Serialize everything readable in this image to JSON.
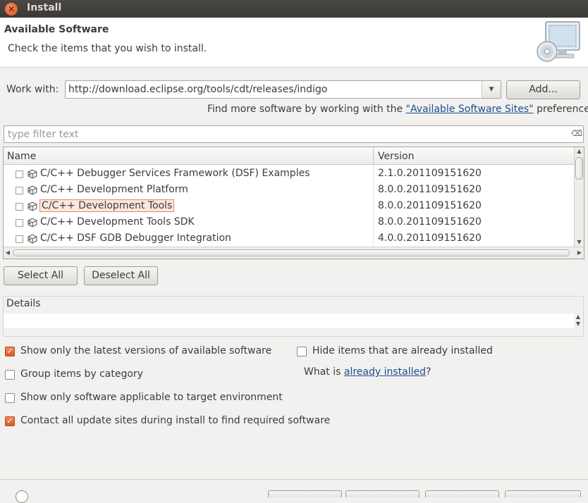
{
  "window": {
    "title": "Install",
    "close_glyph": "✕"
  },
  "header": {
    "title": "Available Software",
    "subtitle": "Check the items that you wish to install.",
    "icon": "monitor-cd-icon"
  },
  "work_with": {
    "label": "Work with:",
    "value": "http://download.eclipse.org/tools/cdt/releases/indigo",
    "add_button": "Add..."
  },
  "find_more": {
    "prefix": "Find more software by working with the ",
    "link": "\"Available Software Sites\"",
    "suffix": " preferences."
  },
  "filter": {
    "placeholder": "type filter text",
    "clear_icon": "clear-filter-icon"
  },
  "table": {
    "columns": [
      "Name",
      "Version"
    ],
    "rows": [
      {
        "name": "C/C++ Debugger Services Framework (DSF) Examples",
        "version": "2.1.0.201109151620",
        "checked": false,
        "selected": false
      },
      {
        "name": "C/C++ Development Platform",
        "version": "8.0.0.201109151620",
        "checked": false,
        "selected": false
      },
      {
        "name": "C/C++ Development Tools",
        "version": "8.0.0.201109151620",
        "checked": false,
        "selected": true
      },
      {
        "name": "C/C++ Development Tools SDK",
        "version": "8.0.0.201109151620",
        "checked": false,
        "selected": false
      },
      {
        "name": "C/C++ DSF GDB Debugger Integration",
        "version": "4.0.0.201109151620",
        "checked": false,
        "selected": false
      }
    ]
  },
  "buttons": {
    "select_all": "Select All",
    "deselect_all": "Deselect All"
  },
  "details": {
    "label": "Details",
    "text": ""
  },
  "options": {
    "latest_versions": {
      "label": "Show only the latest versions of available software",
      "checked": true
    },
    "group_by_category": {
      "label": "Group items by category",
      "checked": false
    },
    "target_env": {
      "label": "Show only software applicable to target environment",
      "checked": false
    },
    "contact_sites": {
      "label": "Contact all update sites during install to find required software",
      "checked": true
    },
    "hide_installed": {
      "label": "Hide items that are already installed",
      "checked": false
    }
  },
  "what_is": {
    "prefix": "What is ",
    "link": "already installed",
    "suffix": "?"
  },
  "colors": {
    "accent": "#e0521d",
    "link": "#1a4f8f",
    "selection_border": "#e9866a"
  }
}
